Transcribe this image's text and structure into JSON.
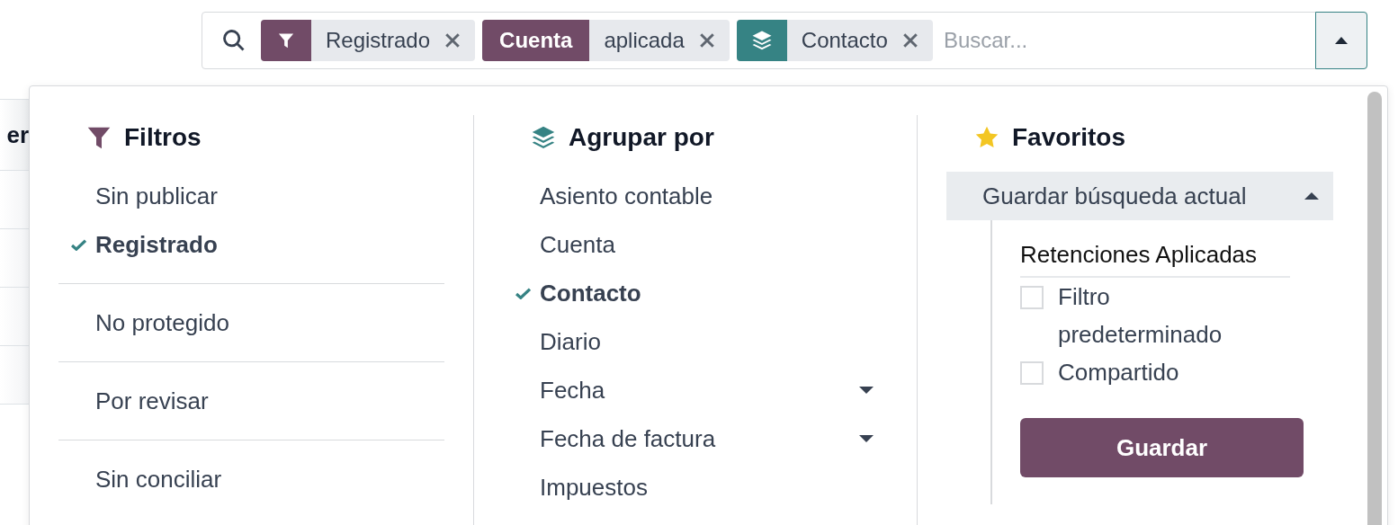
{
  "search": {
    "facets": [
      {
        "kind": "filter",
        "values": [
          "Registrado"
        ]
      },
      {
        "kind": "field",
        "title": "Cuenta",
        "values": [
          "aplicada"
        ]
      },
      {
        "kind": "groupby",
        "values": [
          "Contacto"
        ]
      }
    ],
    "placeholder": "Buscar...",
    "expanded": true
  },
  "table": {
    "column_1": "er"
  },
  "filters": {
    "title": "Filtros",
    "groups": [
      {
        "items": [
          {
            "label": "Sin publicar",
            "checked": false
          },
          {
            "label": "Registrado",
            "checked": true
          }
        ]
      },
      {
        "items": [
          {
            "label": "No protegido",
            "checked": false
          }
        ]
      },
      {
        "items": [
          {
            "label": "Por revisar",
            "checked": false
          }
        ]
      },
      {
        "items": [
          {
            "label": "Sin conciliar",
            "checked": false
          }
        ]
      }
    ]
  },
  "group_by": {
    "title": "Agrupar por",
    "items": [
      {
        "label": "Asiento contable",
        "checked": false,
        "has_submenu": false
      },
      {
        "label": "Cuenta",
        "checked": false,
        "has_submenu": false
      },
      {
        "label": "Contacto",
        "checked": true,
        "has_submenu": false
      },
      {
        "label": "Diario",
        "checked": false,
        "has_submenu": false
      },
      {
        "label": "Fecha",
        "checked": false,
        "has_submenu": true
      },
      {
        "label": "Fecha de factura",
        "checked": false,
        "has_submenu": true
      },
      {
        "label": "Impuestos",
        "checked": false,
        "has_submenu": false
      }
    ]
  },
  "favorites": {
    "title": "Favoritos",
    "save_current": {
      "label": "Guardar búsqueda actual",
      "expanded": true,
      "name_value": "Retenciones Aplicadas",
      "options": [
        {
          "label": "Filtro predeterminado",
          "checked": false
        },
        {
          "label": "Compartido",
          "checked": false
        }
      ],
      "button": "Guardar"
    }
  }
}
